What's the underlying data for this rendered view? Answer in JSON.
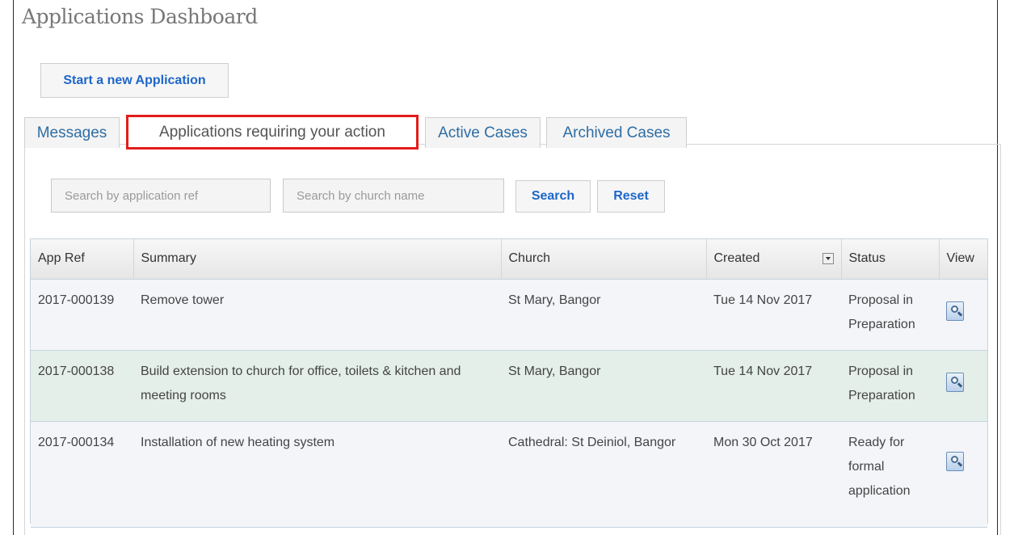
{
  "page": {
    "title": "Applications Dashboard"
  },
  "actions": {
    "new_application": "Start a new Application"
  },
  "tabs": [
    {
      "label": "Messages"
    },
    {
      "label": "Applications requiring your action",
      "selected": true
    },
    {
      "label": "Active Cases"
    },
    {
      "label": "Archived Cases"
    }
  ],
  "search": {
    "ref_placeholder": "Search by application ref",
    "church_placeholder": "Search by church name",
    "search_label": "Search",
    "reset_label": "Reset"
  },
  "table": {
    "headers": [
      "App Ref",
      "Summary",
      "Church",
      "Created",
      "Status",
      "View"
    ],
    "rows": [
      {
        "ref": "2017-000139",
        "summary": "Remove tower",
        "church": "St Mary, Bangor",
        "created": "Tue 14 Nov 2017",
        "status": "Proposal in Preparation"
      },
      {
        "ref": "2017-000138",
        "summary": "Build extension to church for office, toilets & kitchen and meeting rooms",
        "church": "St Mary, Bangor",
        "created": "Tue 14 Nov 2017",
        "status": "Proposal in Preparation"
      },
      {
        "ref": "2017-000134",
        "summary": "Installation of new heating system",
        "church": "Cathedral: St Deiniol, Bangor",
        "created": "Mon 30 Oct 2017",
        "status": "Ready for formal application"
      }
    ]
  },
  "colors": {
    "link_blue": "#1d66c9",
    "tab_highlight": "#e41c1c",
    "row_highlight": "#e3efe8"
  },
  "icons": {
    "view": "magnifier-document-icon",
    "sort": "dropdown-arrow-icon"
  }
}
